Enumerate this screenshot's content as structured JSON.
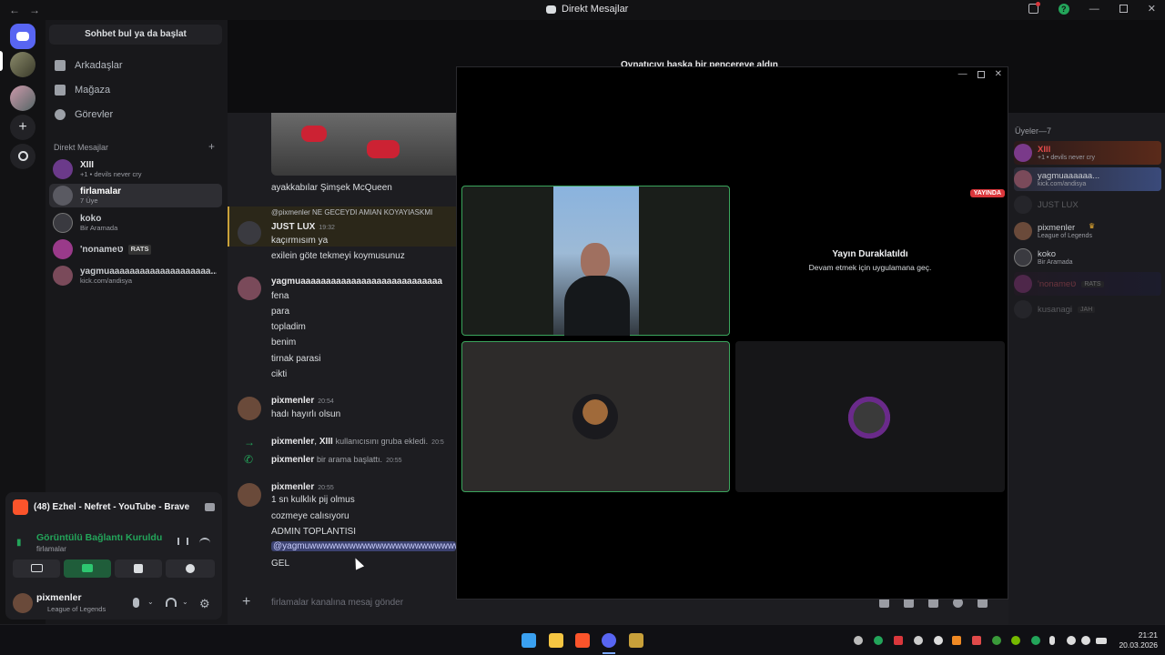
{
  "window": {
    "back": "←",
    "forward": "→",
    "title": "Direkt Mesajlar"
  },
  "search": {
    "label": "Sohbet bul ya da başlat"
  },
  "nav": [
    {
      "label": "Arkadaşlar",
      "icon": "friends-icon"
    },
    {
      "label": "Mağaza",
      "icon": "shop-icon"
    },
    {
      "label": "Görevler",
      "icon": "quests-icon"
    }
  ],
  "dm_header": {
    "label": "Direkt Mesajlar",
    "add": "+"
  },
  "dms": [
    {
      "name": "XIII",
      "sub": "+1 • devils never cry",
      "color": "#6b3a8a"
    },
    {
      "name": "firlamalar",
      "sub": "7 Üye",
      "color": "#5a5a62"
    },
    {
      "name": "koko",
      "sub": "Bir Aramada",
      "color": "#3a3a40"
    },
    {
      "name": "'nonameטּ",
      "sub": "RATS",
      "color": "#9a3a8a"
    },
    {
      "name": "yagmuaaaaaaaaaaaaaaaaaaaa...",
      "sub": "kick.com/andisya",
      "color": "#7a4a5a"
    }
  ],
  "chat_head": {
    "notice": "Oynatıcıyı başka bir pencereye aldın"
  },
  "messages": {
    "caption1": "ayakkabılar Şimşek McQueen",
    "reply_ref": "@pixmenler NE GECEYDI AMIAN KOYAYIASKMI",
    "m2_author": "JUST LUX",
    "m2_time": "19:32",
    "m2_lines": [
      "kaçırmısım ya",
      "exilein göte tekmeyi koymusunuz"
    ],
    "m3_author": "yagmuaaaaaaaaaaaaaaaaaaaaaaaaaaaa",
    "m3_lines": [
      "fena",
      "para",
      "topladim",
      "benim",
      "tirnak parasi",
      "cikti"
    ],
    "m4_author": "pixmenler",
    "m4_time": "20:54",
    "m4_text": "hadı hayırlı olsun",
    "sys1_a": "pixmenler",
    "sys1_b": "XIII",
    "sys1_text": "kullanıcısını gruba ekledi.",
    "sys1_time": "20:5",
    "sys2_a": "pixmenler",
    "sys2_text": "bir arama başlattı.",
    "sys2_time": "20:55",
    "m5_author": "pixmenler",
    "m5_time": "20:55",
    "m5_lines": [
      "1 sn kulklık pij olmus",
      "cozmeye calısıyoru",
      "ADMIN TOPLANTISI"
    ],
    "mention": "@yagmuwwwwwwwwwwwwwwwwwwwwwwwwww",
    "m5_last": "GEL"
  },
  "composer": {
    "placeholder": "firlamalar kanalına mesaj gönder",
    "plus": "+"
  },
  "members": {
    "header": "Üyeler—7",
    "list": [
      {
        "name": "XIII",
        "sub": "+1 • devils never cry",
        "color": "#7a3a8a",
        "dim": false
      },
      {
        "name": "yagmuaaaaaa...",
        "sub": "kick.com/andisya",
        "color": "#7a4a5a",
        "dim": false
      },
      {
        "name": "JUST LUX",
        "sub": "",
        "color": "#3a3a40",
        "dim": true
      },
      {
        "name": "pixmenler",
        "sub": "League of Legends",
        "color": "#6a4a3a",
        "dim": false
      },
      {
        "name": "koko",
        "sub": "Bir Aramada",
        "color": "#3a3a40",
        "dim": false
      },
      {
        "name": "'nonameטּ",
        "sub": "RATS",
        "color": "#9a3a8a",
        "dim": true
      },
      {
        "name": "kusanagi",
        "sub": "JAH",
        "color": "#3a3a40",
        "dim": true
      }
    ]
  },
  "popout": {
    "live": "YAYINDA",
    "paused_title": "Yayın Duraklatıldı",
    "paused_sub": "Devam etmek için uygulamana geç."
  },
  "panel": {
    "stream": "(48) Ezhel - Nefret - YouTube - Brave",
    "status": "Görüntülü Bağlantı Kuruldu",
    "channel": "firlamalar",
    "user": "pixmenler",
    "activity": "League of Legends"
  },
  "taskbar": {
    "time": "21:21",
    "date": "20.03.2026"
  },
  "colors": {
    "accent": "#5865f2",
    "green": "#23a55a",
    "live": "#da373c",
    "tile_border": "#3ba55c"
  }
}
